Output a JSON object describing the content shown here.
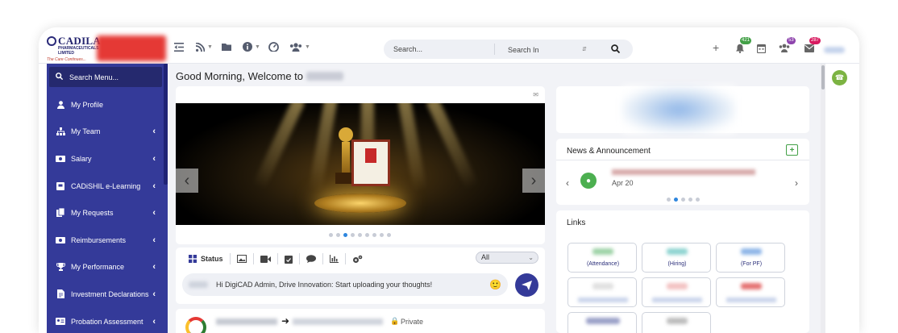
{
  "brand": {
    "name": "CADILA",
    "sub": "PHARMACEUTICALS LIMITED",
    "tagline": "The Care Continues..."
  },
  "search": {
    "placeholder": "Search...",
    "scope": "Search In"
  },
  "badges": {
    "notifications": "421",
    "team": "53",
    "mail": "287"
  },
  "sidebar": {
    "search_label": "Search Menu...",
    "items": [
      {
        "label": "My Profile",
        "icon": "user-icon",
        "chevron": false
      },
      {
        "label": "My Team",
        "icon": "sitemap-icon",
        "chevron": true
      },
      {
        "label": "Salary",
        "icon": "money-icon",
        "chevron": true
      },
      {
        "label": "CADiSHIL e-Learning",
        "icon": "book-icon",
        "chevron": true
      },
      {
        "label": "My Requests",
        "icon": "copy-icon",
        "chevron": true
      },
      {
        "label": "Reimbursements",
        "icon": "money-icon",
        "chevron": true
      },
      {
        "label": "My Performance",
        "icon": "trophy-icon",
        "chevron": true
      },
      {
        "label": "Investment Declarations",
        "icon": "document-icon",
        "chevron": true
      },
      {
        "label": "Probation Assessment",
        "icon": "id-card-icon",
        "chevron": true
      }
    ]
  },
  "greeting": "Good Morning, Welcome to",
  "status_panel": {
    "tab_status": "Status",
    "filter_value": "All",
    "post_text": "Hi DigiCAD Admin, Drive Innovation: Start uploading your thoughts!"
  },
  "feed": {
    "privacy": "Private"
  },
  "news": {
    "title": "News & Announcement",
    "date": "Apr 20"
  },
  "links": {
    "title": "Links",
    "tiles": [
      {
        "label": "(Attendance)",
        "color": "#9fd3a8"
      },
      {
        "label": "(Hiring)",
        "color": "#8fd4d1"
      },
      {
        "label": "(For PF)",
        "color": "#8fb6e8"
      }
    ]
  },
  "colors": {
    "sidebar": "#343a99",
    "accent_blue": "#2e86de",
    "badge_green": "#43a047",
    "badge_purple": "#8e44ad",
    "badge_pink": "#d81b60"
  }
}
